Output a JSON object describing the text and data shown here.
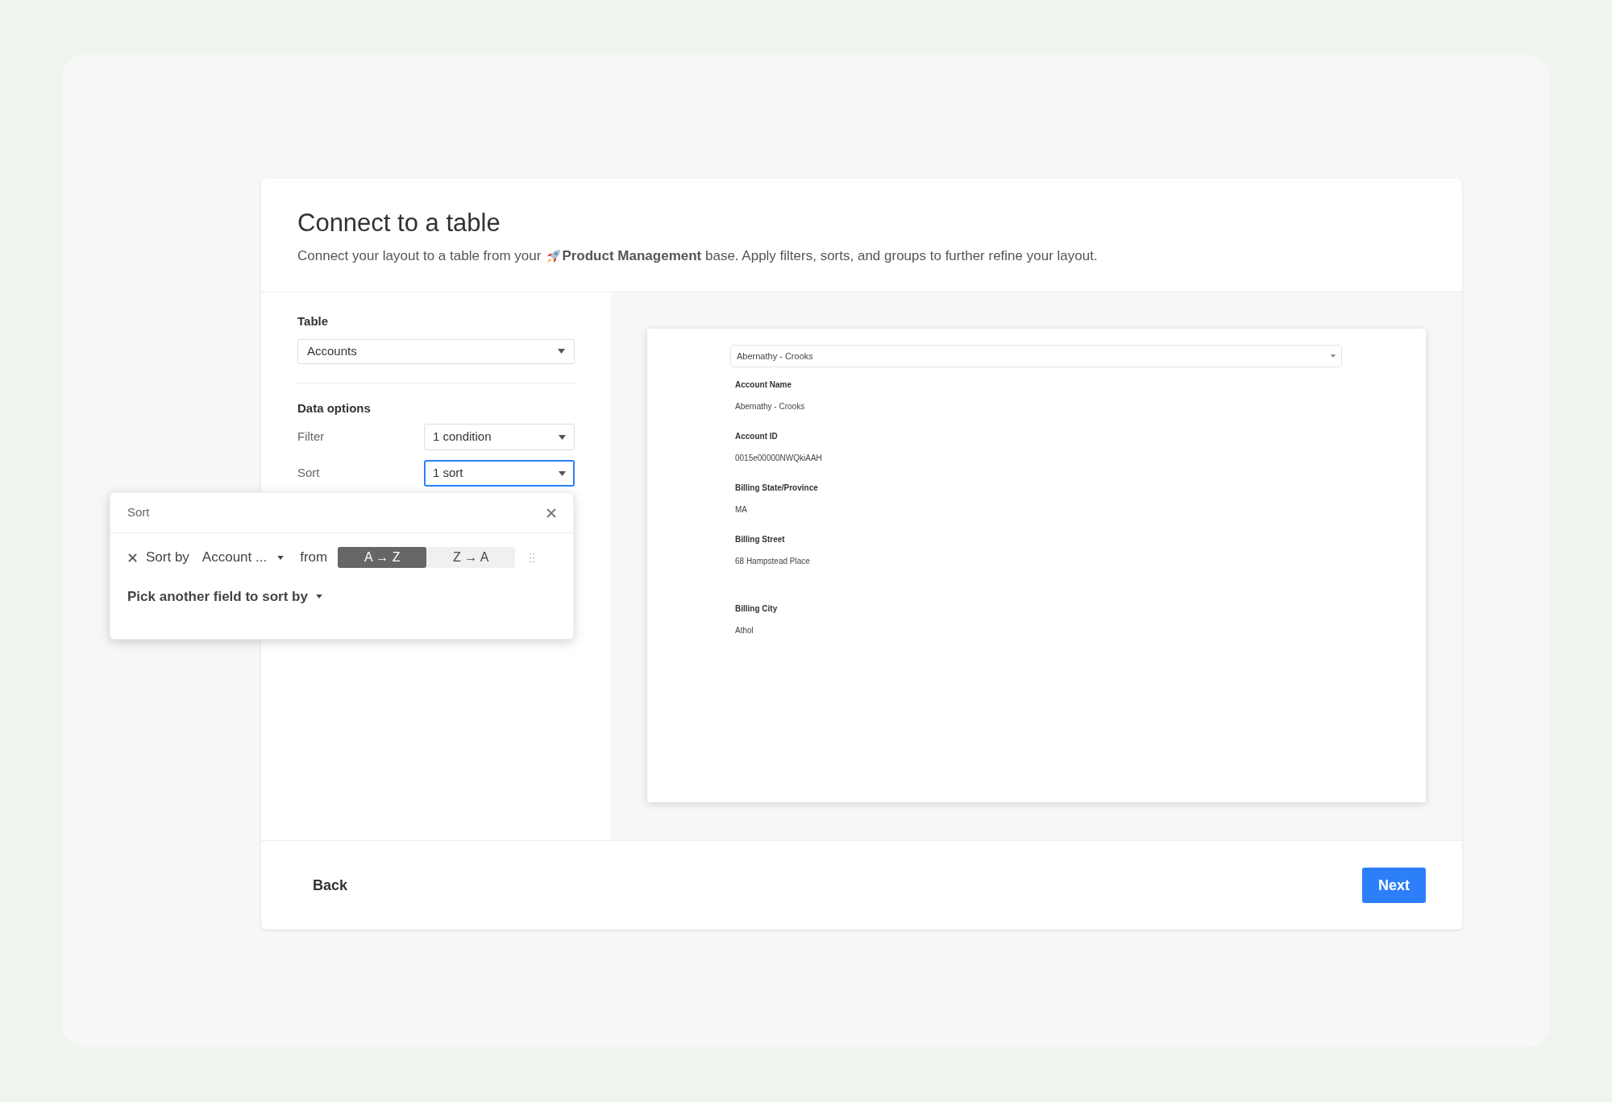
{
  "dialog": {
    "title": "Connect to a table",
    "subtitle_start": "Connect your layout to a table from your",
    "subtitle_end": "**Product Management** base. Apply filters, sorts, and groups to further refine your layout."
  },
  "table": {
    "label": "Table",
    "value": "Accounts"
  },
  "data_options": {
    "heading": "Data options",
    "rows": [
      {
        "label": "Filter",
        "value": "1 condition",
        "focused": false
      },
      {
        "label": "Sort",
        "value": "1 sort",
        "focused": true
      }
    ]
  },
  "sort_popover": {
    "title": "Sort",
    "sort_by_label": "Sort by",
    "field": "Account ...",
    "from_label": "from",
    "directions": [
      {
        "label": "A → Z",
        "selected": true
      },
      {
        "label": "Z → A",
        "selected": false
      }
    ],
    "add_field": "Pick another field to sort by"
  },
  "preview": {
    "record": "Abernathy - Crooks",
    "fields": [
      {
        "label": "Account Name",
        "value": "Abernathy - Crooks"
      },
      {
        "label": "Account ID",
        "value": "0015e00000NWQkiAAH"
      },
      {
        "label": "Billing State/Province",
        "value": "MA"
      },
      {
        "label": "Billing Street",
        "value": "68 Hampstead Place"
      },
      {
        "label": "Billing City",
        "value": "Athol"
      }
    ]
  },
  "footer": {
    "back": "Back",
    "next": "Next"
  }
}
